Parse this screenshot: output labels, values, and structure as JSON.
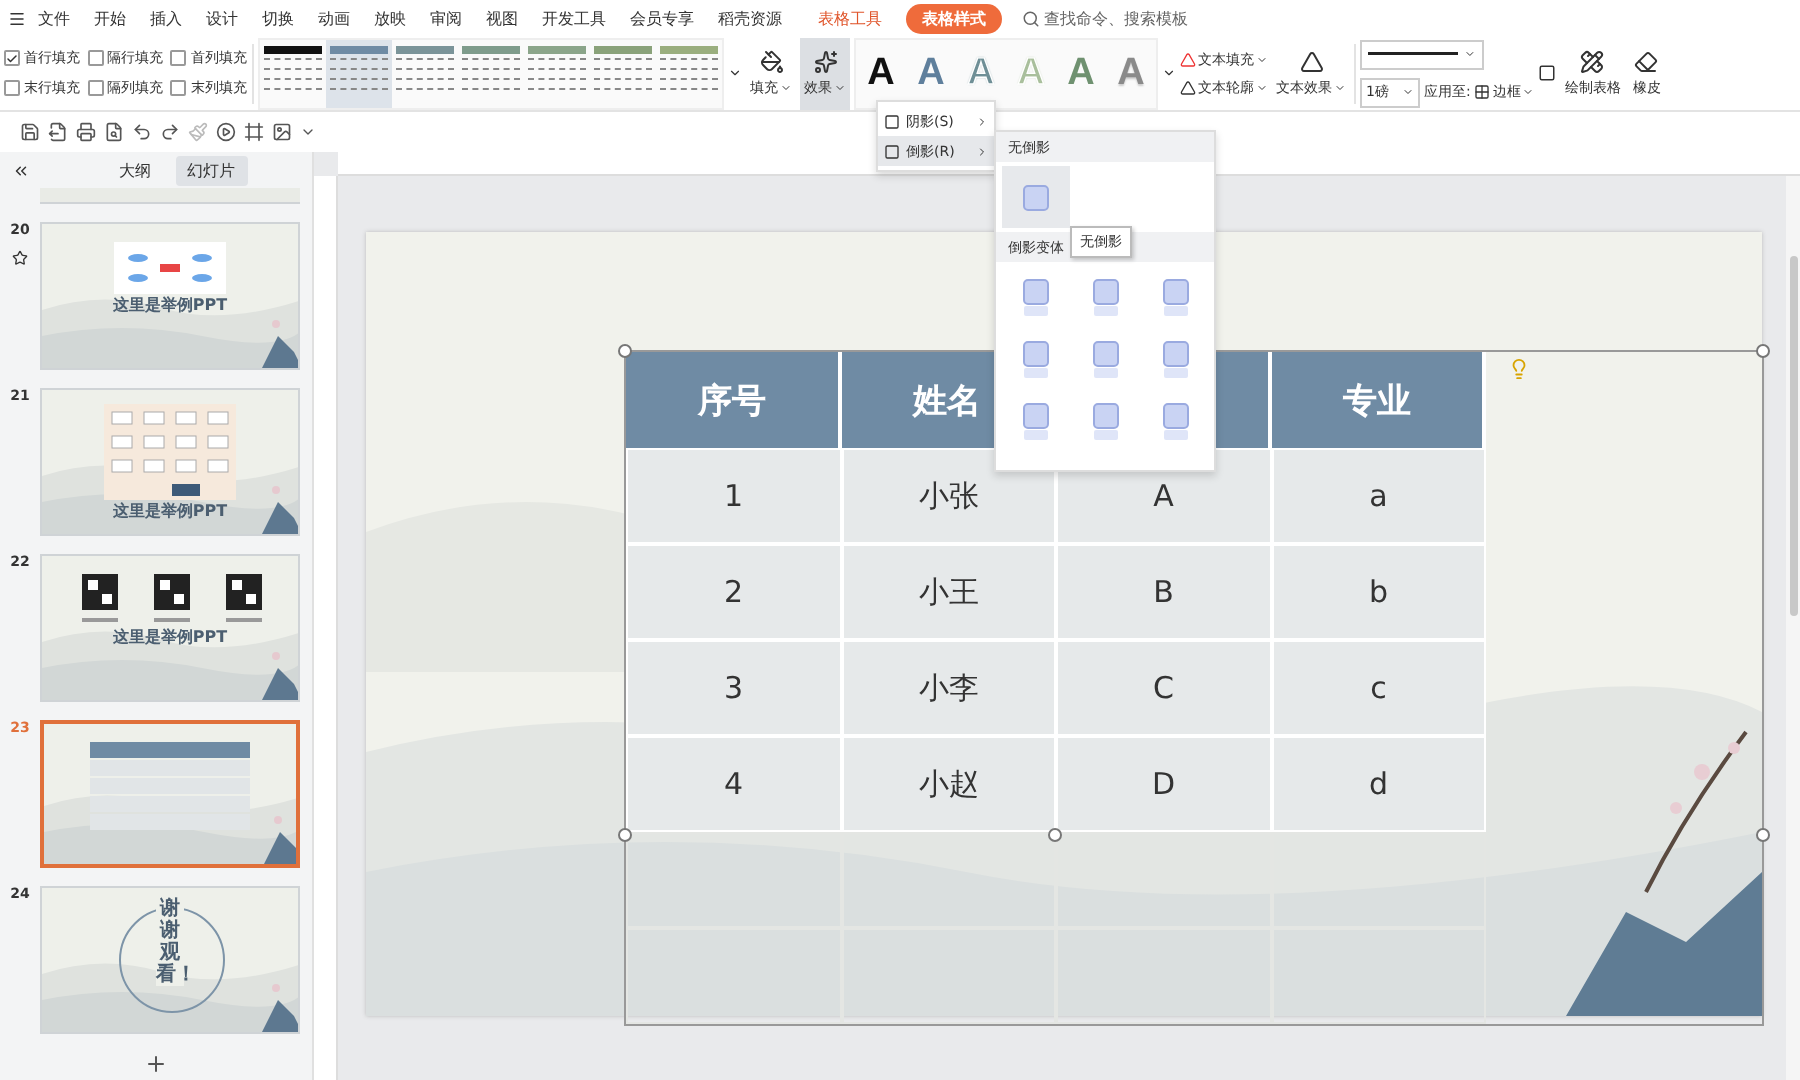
{
  "menu_bar": {
    "items": [
      {
        "label": "文件"
      },
      {
        "label": "开始"
      },
      {
        "label": "插入"
      },
      {
        "label": "设计"
      },
      {
        "label": "切换"
      },
      {
        "label": "动画"
      },
      {
        "label": "放映"
      },
      {
        "label": "审阅"
      },
      {
        "label": "视图"
      },
      {
        "label": "开发工具"
      },
      {
        "label": "会员专享"
      },
      {
        "label": "稻壳资源"
      }
    ],
    "context_tabs": [
      {
        "label": "表格工具",
        "selected": false
      },
      {
        "label": "表格样式",
        "selected": true
      }
    ],
    "search": {
      "placeholder": "查找命令、搜索模板"
    }
  },
  "ribbon": {
    "options": [
      {
        "label": "首行填充",
        "checked": true
      },
      {
        "label": "隔行填充",
        "checked": false
      },
      {
        "label": "首列填充",
        "checked": false
      },
      {
        "label": "末行填充",
        "checked": false
      },
      {
        "label": "隔列填充",
        "checked": false
      },
      {
        "label": "末列填充",
        "checked": false
      }
    ],
    "table_styles": [
      {
        "color": "#111111",
        "selected": false
      },
      {
        "color": "#6f8ba4",
        "selected": true
      },
      {
        "color": "#7b9499",
        "selected": false
      },
      {
        "color": "#7f9c8c",
        "selected": false
      },
      {
        "color": "#8ba58a",
        "selected": false
      },
      {
        "color": "#8aa27a",
        "selected": false
      },
      {
        "color": "#9aae7e",
        "selected": false
      }
    ],
    "fill_button": {
      "label": "填充"
    },
    "effects_button": {
      "label": "效果",
      "pressed": true
    },
    "text_styles": [
      {
        "letter": "A",
        "kind": "solid",
        "color": "#111111"
      },
      {
        "letter": "A",
        "kind": "solid",
        "color": "#5f7f9c"
      },
      {
        "letter": "A",
        "kind": "outline",
        "color": "#6f8f96"
      },
      {
        "letter": "A",
        "kind": "outline",
        "color": "#a9bf9c"
      },
      {
        "letter": "A",
        "kind": "solid",
        "color": "#6f9170"
      },
      {
        "letter": "A",
        "kind": "gradient",
        "color": "#8a8a8a"
      }
    ],
    "text_fill": "文本填充",
    "text_outline": "文本轮廓",
    "text_effects": "文本效果",
    "line_weight": "1磅",
    "apply_to": "应用至:",
    "border": "边框",
    "draw_table": "绘制表格",
    "eraser": "橡皮"
  },
  "panel": {
    "tabs": [
      {
        "label": "大纲",
        "selected": false
      },
      {
        "label": "幻灯片",
        "selected": true
      }
    ],
    "slides": [
      {
        "number": "20",
        "starred": true,
        "selected": false,
        "kind": "mindmap",
        "title": "这里是举例PPT"
      },
      {
        "number": "21",
        "starred": false,
        "selected": false,
        "kind": "flowchart",
        "title": "这里是举例PPT"
      },
      {
        "number": "22",
        "starred": false,
        "selected": false,
        "kind": "qrcodes",
        "title": "这里是举例PPT"
      },
      {
        "number": "23",
        "starred": false,
        "selected": true,
        "kind": "table"
      },
      {
        "number": "24",
        "starred": false,
        "selected": false,
        "kind": "ending",
        "title": "谢谢观看！"
      }
    ]
  },
  "table": {
    "columns": [
      {
        "label": "序号"
      },
      {
        "label": "姓名"
      },
      {},
      {
        "label": "专业"
      }
    ],
    "rows": [
      [
        "1",
        "小张",
        "A",
        "a"
      ],
      [
        "2",
        "小王",
        "B",
        "b"
      ],
      [
        "3",
        "小李",
        "C",
        "c"
      ],
      [
        "4",
        "小赵",
        "D",
        "d"
      ]
    ]
  },
  "menu": {
    "items": [
      {
        "label": "阴影(S)",
        "selected": false
      },
      {
        "label": "倒影(R)",
        "selected": true
      }
    ]
  },
  "submenu": {
    "sections": [
      {
        "title": "无倒影",
        "tiles": [
          {
            "selected": true
          }
        ]
      },
      {
        "title": "倒影变体",
        "tiles": [
          {
            "selected": false
          },
          {
            "selected": false
          },
          {
            "selected": false
          },
          {
            "selected": false
          },
          {
            "selected": false
          },
          {
            "selected": false
          },
          {
            "selected": false
          },
          {
            "selected": false
          },
          {
            "selected": false
          }
        ]
      }
    ],
    "tooltip": "无倒影"
  }
}
